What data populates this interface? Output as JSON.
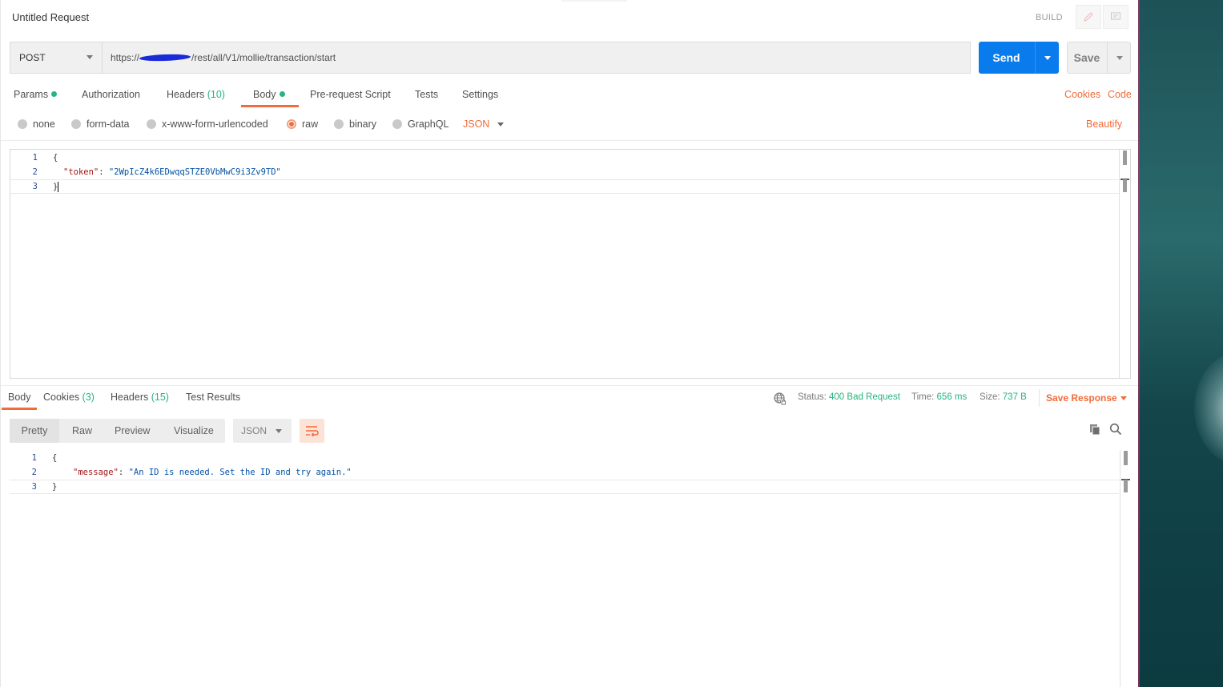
{
  "header": {
    "title": "Untitled Request",
    "build_label": "BUILD"
  },
  "request": {
    "method": "POST",
    "url_prefix": "https://",
    "url_suffix": "/rest/all/V1/mollie/transaction/start",
    "send_label": "Send",
    "save_label": "Save"
  },
  "tabs": {
    "params": "Params",
    "authorization": "Authorization",
    "headers": "Headers",
    "headers_count": "(10)",
    "body": "Body",
    "prerequest": "Pre-request Script",
    "tests": "Tests",
    "settings": "Settings",
    "cookies": "Cookies",
    "code": "Code"
  },
  "body_types": {
    "none": "none",
    "form_data": "form-data",
    "urlencoded": "x-www-form-urlencoded",
    "raw": "raw",
    "binary": "binary",
    "graphql": "GraphQL",
    "format": "JSON",
    "beautify": "Beautify"
  },
  "request_body": {
    "line_numbers": [
      "1",
      "2",
      "3"
    ],
    "open_brace": "{",
    "key": "\"token\"",
    "colon": ": ",
    "value": "\"2WpIcZ4k6EDwqqSTZE0VbMwC9i3Zv9TD\"",
    "close_brace": "}"
  },
  "response": {
    "tabs": {
      "body": "Body",
      "cookies": "Cookies",
      "cookies_count": "(3)",
      "headers": "Headers",
      "headers_count": "(15)",
      "test_results": "Test Results"
    },
    "status_label": "Status:",
    "status_value": "400 Bad Request",
    "time_label": "Time:",
    "time_value": "656 ms",
    "size_label": "Size:",
    "size_value": "737 B",
    "save_response": "Save Response",
    "modes": {
      "pretty": "Pretty",
      "raw": "Raw",
      "preview": "Preview",
      "visualize": "Visualize"
    },
    "format": "JSON",
    "body": {
      "line_numbers": [
        "1",
        "2",
        "3"
      ],
      "open_brace": "{",
      "key": "\"message\"",
      "colon": ": ",
      "value": "\"An ID is needed. Set the ID and try again.\"",
      "close_brace": "}"
    }
  },
  "colors": {
    "accent": "#f26b3a",
    "send_blue": "#097bed",
    "success_green": "#26b47f"
  }
}
